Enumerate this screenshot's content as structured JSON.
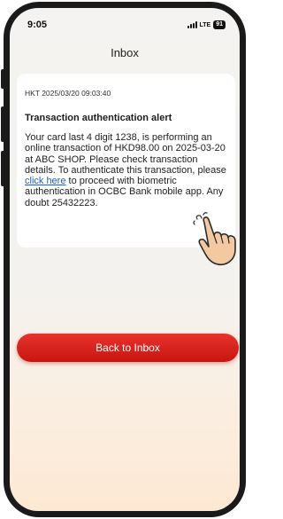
{
  "status_bar": {
    "time": "9:05",
    "network": "LTE",
    "battery": "91"
  },
  "header": {
    "title": "Inbox"
  },
  "message": {
    "meta": "HKT 2025/03/20 09:03:40",
    "title": "Transaction authentication alert",
    "body_before_link": "Your card last 4 digit 1238, is performing an online transaction of HKD98.00 on 2025-03-20 at ABC SHOP. Please check transaction details. To authenticate this transaction, please ",
    "link_text": "click here",
    "body_after_link": " to proceed with biometric authentication in OCBC Bank mobile app. Any doubt 25432223."
  },
  "actions": {
    "back_label": "Back to Inbox"
  },
  "colors": {
    "accent_red": "#d9241c",
    "link_blue": "#1a5fd6",
    "hand_skin": "#f2c9a0"
  },
  "icons": {
    "pointer": "hand-pointer-icon",
    "signal": "signal-icon"
  }
}
